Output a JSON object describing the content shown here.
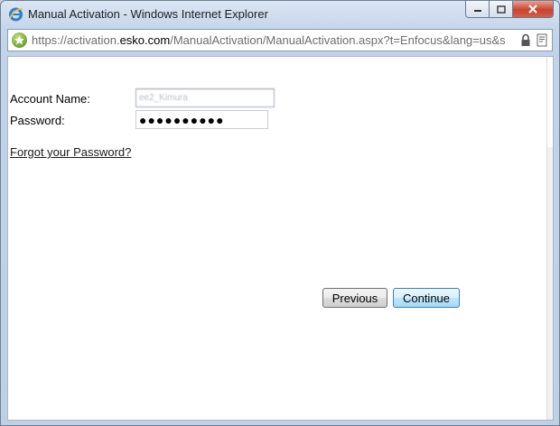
{
  "window": {
    "title": "Manual Activation - Windows Internet Explorer",
    "app_icon": "internet-explorer-icon"
  },
  "address_bar": {
    "url_prefix": "https://activation.",
    "url_domain": "esko.com",
    "url_path": "/ManualActivation/ManualActivation.aspx?t=Enfocus&lang=us&s",
    "secure_icon": "secure-site-icon",
    "lock_icon": "lock-icon",
    "cert_icon": "certificate-icon"
  },
  "form": {
    "account_label": "Account Name:",
    "account_value": "ee2_Kimura",
    "password_label": "Password:",
    "password_value": "●●●●●●●●●●",
    "forgot_link": "Forgot your Password?"
  },
  "buttons": {
    "previous": "Previous",
    "continue": "Continue"
  }
}
